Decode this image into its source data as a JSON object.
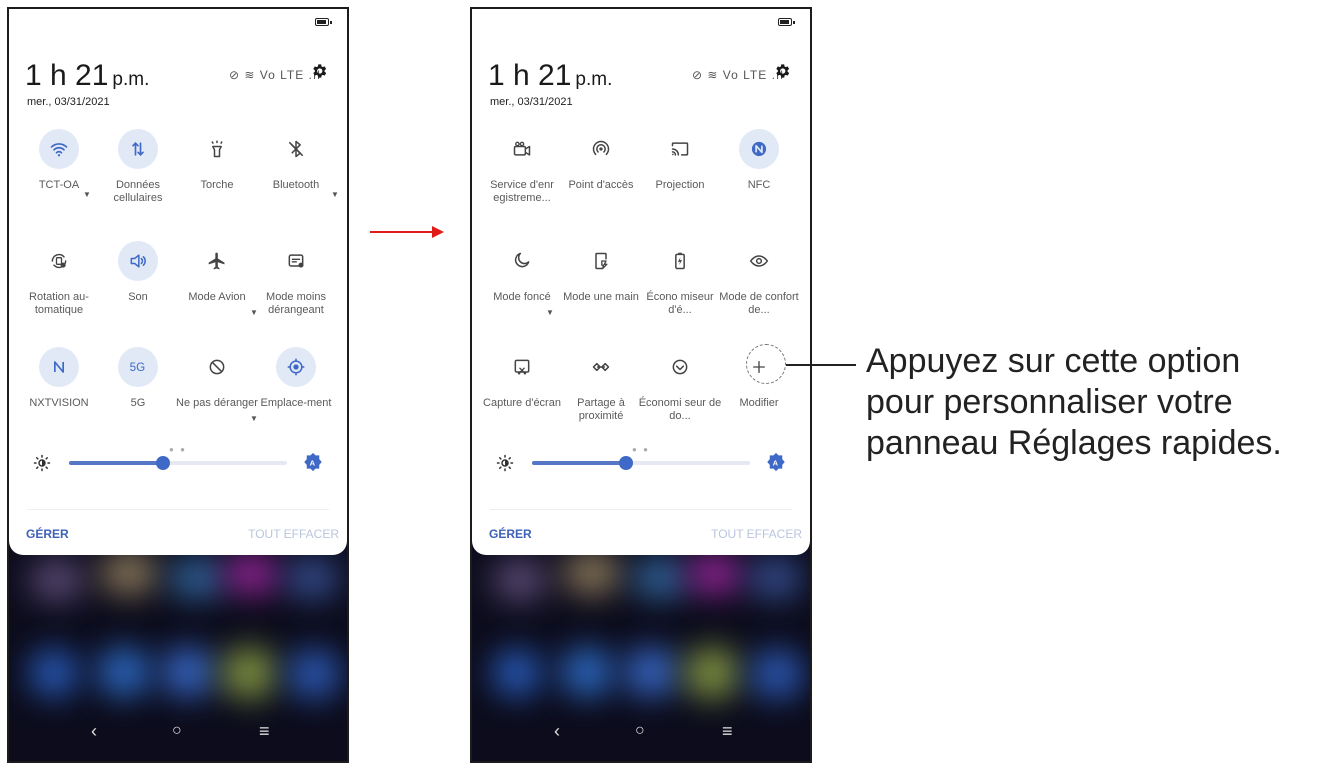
{
  "phones": [
    {
      "clock": {
        "time": "1 h 21",
        "ampm": "p.m.",
        "date": "mer., 03/31/2021"
      },
      "status_icons": "⊘ ≋ Vo LTE .ıl",
      "tiles": [
        {
          "icon": "wifi-icon",
          "label": "TCT-OA",
          "active": true,
          "caret": true
        },
        {
          "icon": "mobile-data-icon",
          "label": "Données cellulaires",
          "active": true
        },
        {
          "icon": "flashlight-icon",
          "label": "Torche",
          "active": false
        },
        {
          "icon": "bluetooth-icon",
          "label": "Bluetooth",
          "active": false,
          "caret": true
        },
        {
          "icon": "auto-rotate-icon",
          "label": "Rotation au-tomatique",
          "active": false
        },
        {
          "icon": "sound-icon",
          "label": "Son",
          "active": true
        },
        {
          "icon": "airplane-icon",
          "label": "Mode Avion",
          "active": false,
          "caret": true
        },
        {
          "icon": "reduced-mode-icon",
          "label": "Mode moins dérangeant",
          "active": false
        },
        {
          "icon": "nxtvision-icon",
          "label": "NXTVISION",
          "active": true
        },
        {
          "icon": "5g-icon",
          "label": "5G",
          "active": true
        },
        {
          "icon": "do-not-disturb-icon",
          "label": "Ne pas déranger",
          "active": false,
          "caret": true
        },
        {
          "icon": "location-icon",
          "label": "Emplace-ment",
          "active": true
        }
      ],
      "brightness": 0.43,
      "manage_label": "GÉRER",
      "clear_label": "TOUT EFFACER"
    },
    {
      "clock": {
        "time": "1 h 21",
        "ampm": "p.m.",
        "date": "mer., 03/31/2021"
      },
      "status_icons": "⊘ ≋ Vo LTE .ıl",
      "tiles": [
        {
          "icon": "screen-recorder-icon",
          "label": "Service d'enr egistreme...",
          "active": false
        },
        {
          "icon": "hotspot-icon",
          "label": "Point d'accès",
          "active": false
        },
        {
          "icon": "cast-icon",
          "label": "Projection",
          "active": false
        },
        {
          "icon": "nfc-icon",
          "label": "NFC",
          "active": true
        },
        {
          "icon": "dark-mode-icon",
          "label": "Mode foncé",
          "active": false,
          "caret": true
        },
        {
          "icon": "one-hand-mode-icon",
          "label": "Mode une main",
          "active": false
        },
        {
          "icon": "battery-saver-icon",
          "label": "Écono miseur d'é...",
          "active": false
        },
        {
          "icon": "eye-comfort-icon",
          "label": "Mode de confort de...",
          "active": false
        },
        {
          "icon": "screenshot-icon",
          "label": "Capture d'écran",
          "active": false
        },
        {
          "icon": "nearby-share-icon",
          "label": "Partage à proximité",
          "active": false
        },
        {
          "icon": "data-saver-icon",
          "label": "Économi seur de do...",
          "active": false
        },
        {
          "icon": "add-icon",
          "label": "Modifier",
          "active": false
        }
      ],
      "brightness": 0.43,
      "manage_label": "GÉRER",
      "clear_label": "TOUT EFFACER"
    }
  ],
  "callout": {
    "line1": "Appuyez sur cette option",
    "line2": "pour personnaliser votre",
    "line3": "panneau Réglages rapides."
  },
  "colors": {
    "accent": "#3f69c6",
    "active_bg": "#e1e9f7",
    "arrow": "#e11a1a"
  }
}
